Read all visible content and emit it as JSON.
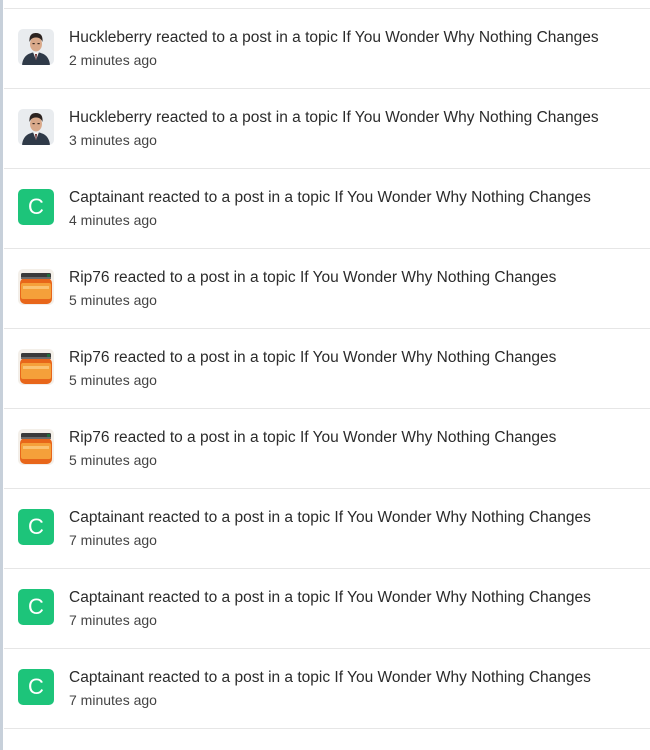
{
  "notifications": [
    {
      "user": "Huckleberry",
      "action": "reacted to a post in a topic",
      "topic": "If You Wonder Why Nothing Changes",
      "time": "2 minutes ago",
      "avatar": "portrait"
    },
    {
      "user": "Huckleberry",
      "action": "reacted to a post in a topic",
      "topic": "If You Wonder Why Nothing Changes",
      "time": "3 minutes ago",
      "avatar": "portrait"
    },
    {
      "user": "Captainant",
      "action": "reacted to a post in a topic",
      "topic": "If You Wonder Why Nothing Changes",
      "time": "4 minutes ago",
      "avatar": "letter",
      "letter": "C"
    },
    {
      "user": "Rip76",
      "action": "reacted to a post in a topic",
      "topic": "If You Wonder Why Nothing Changes",
      "time": "5 minutes ago",
      "avatar": "jar"
    },
    {
      "user": "Rip76",
      "action": "reacted to a post in a topic",
      "topic": "If You Wonder Why Nothing Changes",
      "time": "5 minutes ago",
      "avatar": "jar"
    },
    {
      "user": "Rip76",
      "action": "reacted to a post in a topic",
      "topic": "If You Wonder Why Nothing Changes",
      "time": "5 minutes ago",
      "avatar": "jar"
    },
    {
      "user": "Captainant",
      "action": "reacted to a post in a topic",
      "topic": "If You Wonder Why Nothing Changes",
      "time": "7 minutes ago",
      "avatar": "letter",
      "letter": "C"
    },
    {
      "user": "Captainant",
      "action": "reacted to a post in a topic",
      "topic": "If You Wonder Why Nothing Changes",
      "time": "7 minutes ago",
      "avatar": "letter",
      "letter": "C"
    },
    {
      "user": "Captainant",
      "action": "reacted to a post in a topic",
      "topic": "If You Wonder Why Nothing Changes",
      "time": "7 minutes ago",
      "avatar": "letter",
      "letter": "C"
    }
  ],
  "colors": {
    "letter_avatar_bg": "#1dc47a",
    "text": "#2b2b2b",
    "divider": "#e6e6e6"
  }
}
